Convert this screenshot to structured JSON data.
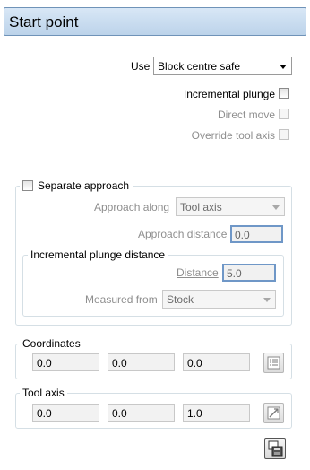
{
  "title": "Start point",
  "use": {
    "label": "Use",
    "value": "Block centre safe"
  },
  "incremental_plunge": {
    "label": "Incremental plunge",
    "checked": false
  },
  "direct_move": {
    "label": "Direct move",
    "checked": false
  },
  "override_tool_axis": {
    "label": "Override tool axis",
    "checked": false
  },
  "separate_approach": {
    "label": "Separate approach",
    "checked": false,
    "approach_along_label": "Approach along",
    "approach_along_value": "Tool axis",
    "approach_distance_label": "Approach distance",
    "approach_distance_value": "0.0",
    "incremental_plunge_distance": {
      "title": "Incremental plunge distance",
      "distance_label": "Distance",
      "distance_value": "5.0",
      "measured_from_label": "Measured from",
      "measured_from_value": "Stock"
    }
  },
  "coordinates": {
    "title": "Coordinates",
    "x": "0.0",
    "y": "0.0",
    "z": "0.0",
    "icon": "coordinate-list-icon"
  },
  "tool_axis": {
    "title": "Tool axis",
    "i": "0.0",
    "j": "0.0",
    "k": "1.0",
    "icon": "axis-direction-icon"
  },
  "footer_icon": "save-to-disk-icon"
}
